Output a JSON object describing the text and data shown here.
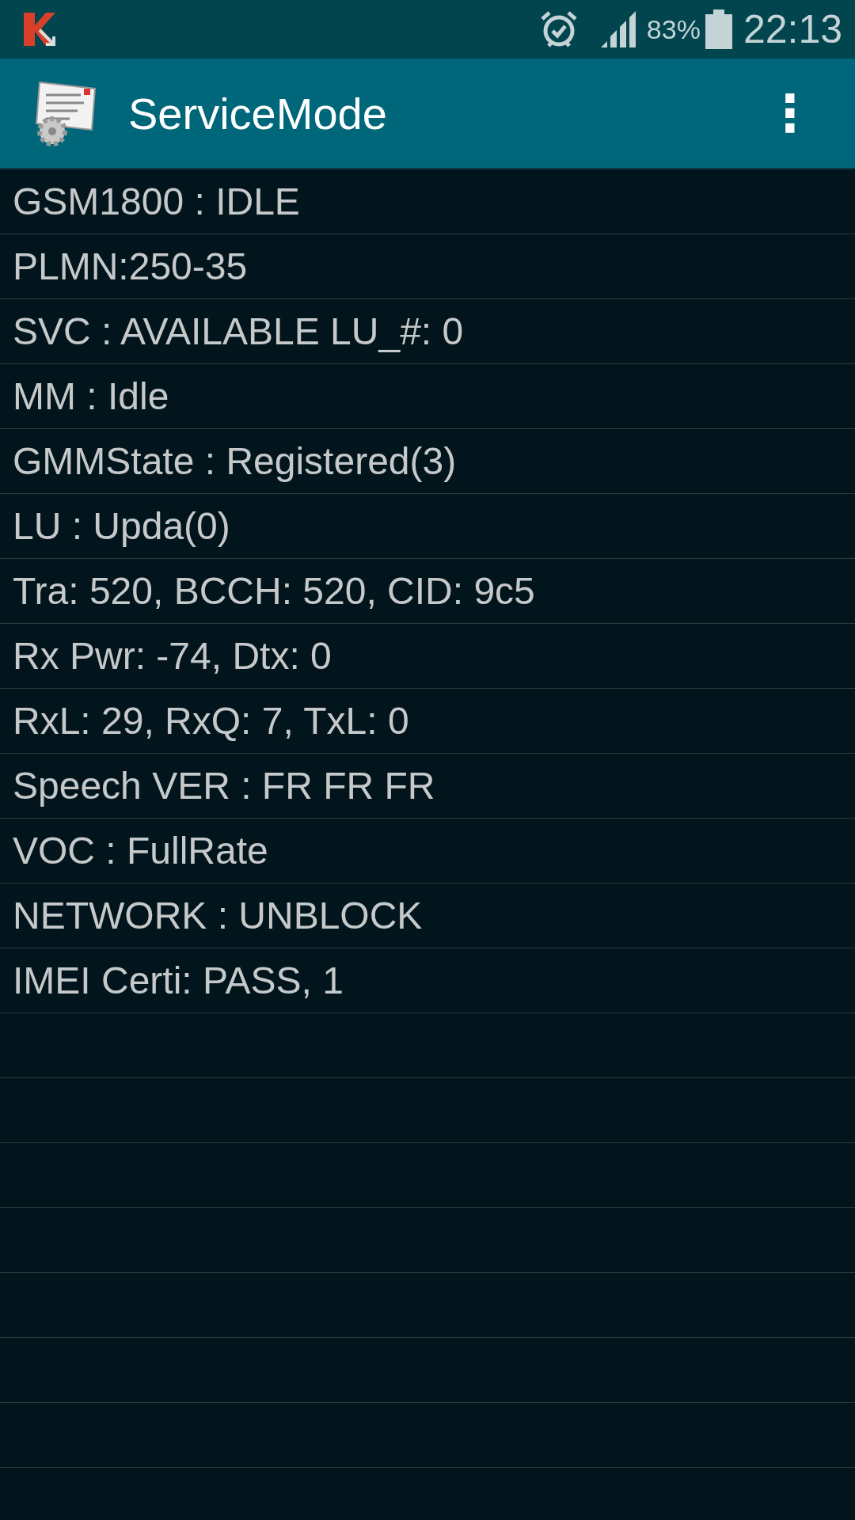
{
  "status_bar": {
    "battery": "83%",
    "time": "22:13"
  },
  "app_bar": {
    "title": "ServiceMode",
    "menu": "⋮"
  },
  "rows": [
    "GSM1800 : IDLE",
    "PLMN:250-35",
    "SVC : AVAILABLE LU_#: 0",
    "MM : Idle",
    "GMMState : Registered(3)",
    "LU : Upda(0)",
    "Tra: 520, BCCH: 520, CID: 9c5",
    "Rx Pwr: -74, Dtx: 0",
    "RxL: 29, RxQ: 7, TxL: 0",
    "Speech VER : FR FR FR",
    "VOC : FullRate",
    "NETWORK : UNBLOCK",
    "IMEI Certi: PASS, 1"
  ]
}
